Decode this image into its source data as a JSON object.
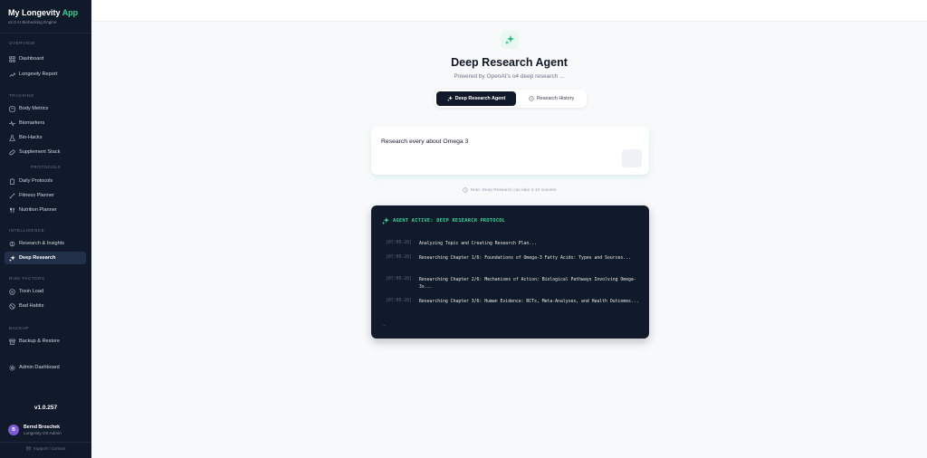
{
  "app": {
    "title_main": "My Longevity",
    "title_accent": "App",
    "subtitle": "v2.0 AI Biohacking Engine"
  },
  "sidebar": {
    "sections": {
      "overview": "OVERVIEW",
      "tracking": "TRACKING",
      "protocols": "PROTOCOLS",
      "intelligence": "INTELLIGENCE",
      "risk_factors": "RISK FACTORS",
      "backup": "BACKUP"
    },
    "items": [
      {
        "label": "Dashboard",
        "icon": "grid-icon"
      },
      {
        "label": "Longevity Report",
        "icon": "trending-up-icon"
      },
      {
        "label": "Body Metrics",
        "icon": "scale-icon"
      },
      {
        "label": "Biomarkers",
        "icon": "activity-icon"
      },
      {
        "label": "Bio-Hacks",
        "icon": "flask-icon"
      },
      {
        "label": "Supplement Stack",
        "icon": "pill-icon"
      },
      {
        "label": "Daily Protocols",
        "icon": "clipboard-icon"
      },
      {
        "label": "Fitness Planner",
        "icon": "dumbbell-icon"
      },
      {
        "label": "Nutrition Planner",
        "icon": "utensils-icon"
      },
      {
        "label": "Research & Insights",
        "icon": "brain-icon"
      },
      {
        "label": "Deep Research",
        "icon": "sparkles-icon",
        "active": true
      },
      {
        "label": "Toxin Load",
        "icon": "toxin-icon"
      },
      {
        "label": "Bad Habits",
        "icon": "ban-icon"
      },
      {
        "label": "Backup & Restore",
        "icon": "archive-icon"
      },
      {
        "label": "Admin Dashboard",
        "icon": "gear-icon"
      }
    ],
    "version": "v1.0.257",
    "user": {
      "initial": "B",
      "name": "Bernd Broschek",
      "role": "Longevity OS Admin"
    },
    "support": "Support / Contact"
  },
  "main": {
    "title": "Deep Research Agent",
    "subtitle": "Powered by OpenAI's o4 deep research ...",
    "tabs": [
      {
        "label": "Deep Research Agent",
        "active": true
      },
      {
        "label": "Research History",
        "active": false
      }
    ],
    "query": "Research every about Omega 3",
    "note": "Note: Deep Research can take 2-10 minutes",
    "terminal": {
      "header": "AGENT ACTIVE: DEEP RESEARCH PROTOCOL",
      "logs": [
        {
          "time": "[07:06:28]",
          "message": "Analyzing Topic and Creating Research Plan..."
        },
        {
          "time": "[07:06:28]",
          "message": "Researching Chapter 1/6: Foundations of Omega-3 Fatty Acids: Types and Sources..."
        },
        {
          "time": "[07:06:28]",
          "message": "Researching Chapter 2/6: Mechanisms of Action: Biological Pathways Involving Omega-3s..."
        },
        {
          "time": "[07:06:28]",
          "message": "Researching Chapter 3/6: Human Evidence: RCTs, Meta-Analyses, and Health Outcomes..."
        }
      ],
      "cursor": "_"
    }
  },
  "colors": {
    "sidebar_bg": "#111a2b",
    "accent": "#34d399",
    "avatar": "#7c5cd6"
  }
}
